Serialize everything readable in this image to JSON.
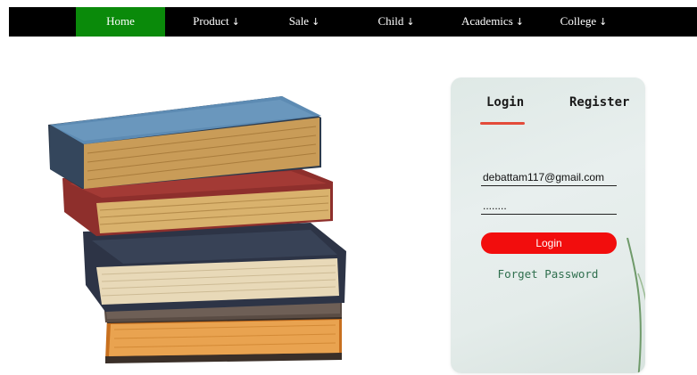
{
  "nav": {
    "items": [
      {
        "label": "Home",
        "arrow": ""
      },
      {
        "label": "Product",
        "arrow": "↓"
      },
      {
        "label": "Sale",
        "arrow": "↓"
      },
      {
        "label": "Child",
        "arrow": "↓"
      },
      {
        "label": "Academics",
        "arrow": "↓"
      },
      {
        "label": "College",
        "arrow": "↓"
      }
    ],
    "active_color": "#0a8a0a"
  },
  "login": {
    "tabs": {
      "login": "Login",
      "register": "Register"
    },
    "email_value": "debattam117@gmail.com",
    "password_value": "........",
    "submit_label": "Login",
    "forget_label": "Forget Password",
    "accent_color": "#f20d0d"
  }
}
